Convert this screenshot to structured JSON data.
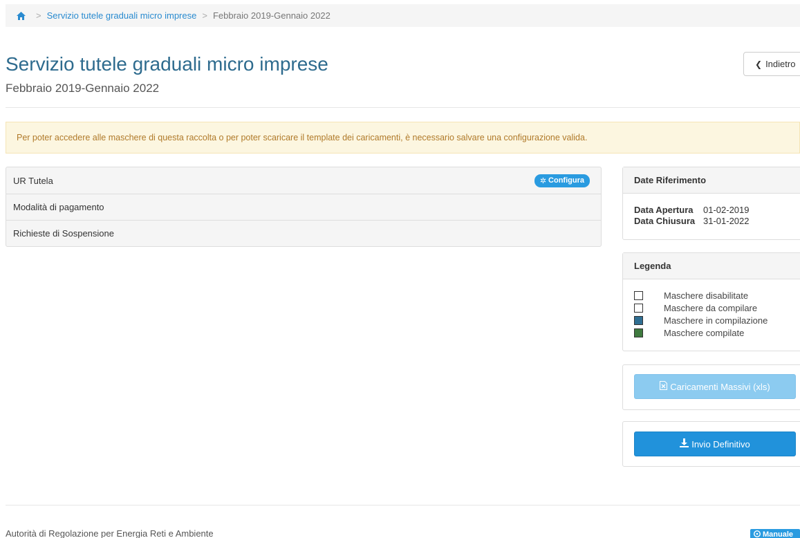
{
  "colors": {
    "accent": "#2a9be0",
    "title": "#2e6b8e",
    "alert_bg": "#fcf6e0",
    "alert_text": "#b07a2a"
  },
  "breadcrumb": {
    "home_icon": "home-icon",
    "separator": ">",
    "items": [
      "Servizio tutele graduali micro imprese",
      "Febbraio 2019-Gennaio 2022"
    ]
  },
  "header": {
    "title": "Servizio tutele graduali micro imprese",
    "subtitle": "Febbraio 2019-Gennaio 2022",
    "back_label": "Indietro",
    "back_icon": "chevron-left-icon"
  },
  "alert": {
    "text": "Per poter accedere alle maschere di questa raccolta o per poter scaricare il template dei caricamenti, è necessario salvare una configurazione valida."
  },
  "masks": {
    "items": [
      {
        "label": "UR Tutela",
        "action": "Configura",
        "action_icon": "gear-icon"
      },
      {
        "label": "Modalità di pagamento"
      },
      {
        "label": "Richieste di Sospensione"
      }
    ]
  },
  "dates": {
    "heading": "Date Riferimento",
    "rows": [
      {
        "label": "Data Apertura",
        "value": "01-02-2019"
      },
      {
        "label": "Data Chiusura",
        "value": "31-01-2022"
      }
    ]
  },
  "legend": {
    "heading": "Legenda",
    "items": [
      {
        "label": "Maschere disabilitate",
        "color": "#ffffff"
      },
      {
        "label": "Maschere da compilare",
        "color": "#ffffff"
      },
      {
        "label": "Maschere in compilazione",
        "color": "#2f6e92"
      },
      {
        "label": "Maschere compilate",
        "color": "#3f7a3f"
      }
    ]
  },
  "actions": {
    "bulk_upload_label": "Caricamenti Massivi (xls)",
    "bulk_upload_icon": "excel-file-icon",
    "final_send_label": "Invio Definitivo",
    "final_send_icon": "download-icon"
  },
  "footer": {
    "text": "Autorità di Regolazione per Energia Reti e Ambiente",
    "manual_label": "Manuale",
    "manual_icon": "help-circle-icon"
  }
}
